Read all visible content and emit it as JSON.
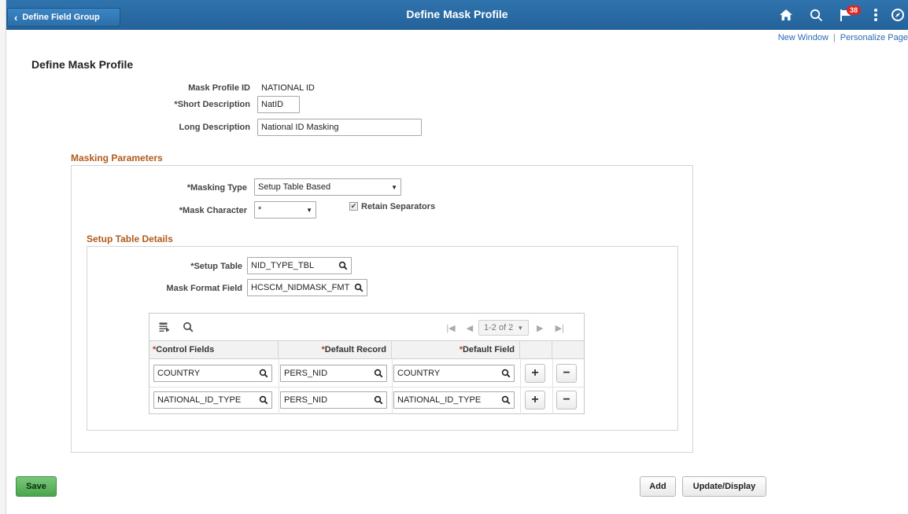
{
  "header": {
    "back_label": "Define Field Group",
    "title": "Define Mask Profile",
    "notification_count": "38"
  },
  "util_links": {
    "new_window": "New Window",
    "separator": "|",
    "personalize": "Personalize Page"
  },
  "page": {
    "title": "Define Mask Profile"
  },
  "form": {
    "mask_profile_id_label": "Mask Profile ID",
    "mask_profile_id_value": "NATIONAL ID",
    "short_desc_label": "*Short Description",
    "short_desc_value": "NatID",
    "long_desc_label": "Long Description",
    "long_desc_value": "National ID Masking"
  },
  "masking": {
    "section_title": "Masking Parameters",
    "type_label": "*Masking Type",
    "type_value": "Setup Table Based",
    "char_label": "*Mask Character",
    "char_value": "*",
    "retain_label": "Retain Separators",
    "retain_checked": true
  },
  "setup": {
    "section_title": "Setup Table Details",
    "table_label": "*Setup Table",
    "table_value": "NID_TYPE_TBL",
    "format_label": "Mask Format Field",
    "format_value": "HCSCM_NIDMASK_FMT"
  },
  "grid": {
    "pager_text": "1-2 of 2",
    "headers": {
      "control": "Control Fields",
      "record": "Default Record",
      "field": "Default Field",
      "required_mark": "*"
    },
    "rows": [
      {
        "control": "COUNTRY",
        "record": "PERS_NID",
        "field": "COUNTRY"
      },
      {
        "control": "NATIONAL_ID_TYPE",
        "record": "PERS_NID",
        "field": "NATIONAL_ID_TYPE"
      }
    ],
    "add_symbol": "+",
    "remove_symbol": "−"
  },
  "buttons": {
    "save": "Save",
    "add": "Add",
    "update_display": "Update/Display"
  },
  "colors": {
    "header_blue": "#2f73ad",
    "section_orange": "#b25a1a",
    "save_green": "#4aa54c",
    "badge_red": "#e0261f"
  }
}
